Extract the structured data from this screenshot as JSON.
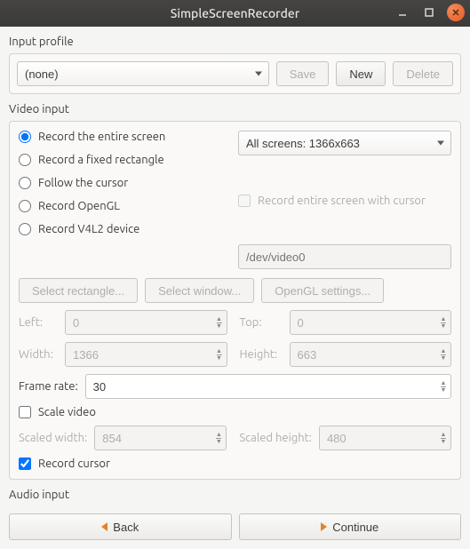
{
  "window": {
    "title": "SimpleScreenRecorder"
  },
  "input_profile": {
    "label": "Input profile",
    "value": "(none)",
    "save": "Save",
    "new": "New",
    "delete": "Delete"
  },
  "video_input": {
    "label": "Video input",
    "radios": {
      "entire": "Record the entire screen",
      "fixed": "Record a fixed rectangle",
      "follow": "Follow the cursor",
      "opengl": "Record OpenGL",
      "v4l2": "Record V4L2 device"
    },
    "screens_value": "All screens: 1366x663",
    "record_entire_cursor": "Record entire screen with cursor",
    "v4l2_device_placeholder": "/dev/video0",
    "buttons": {
      "select_rect": "Select rectangle...",
      "select_window": "Select window...",
      "opengl_settings": "OpenGL settings..."
    },
    "geom": {
      "left_label": "Left:",
      "left_value": "0",
      "top_label": "Top:",
      "top_value": "0",
      "width_label": "Width:",
      "width_value": "1366",
      "height_label": "Height:",
      "height_value": "663"
    },
    "frame_rate": {
      "label": "Frame rate:",
      "value": "30"
    },
    "scale": {
      "label": "Scale video",
      "sw_label": "Scaled width:",
      "sw_value": "854",
      "sh_label": "Scaled height:",
      "sh_value": "480"
    },
    "record_cursor": "Record cursor"
  },
  "audio_input": {
    "label": "Audio input"
  },
  "footer": {
    "back": "Back",
    "continue": "Continue"
  }
}
